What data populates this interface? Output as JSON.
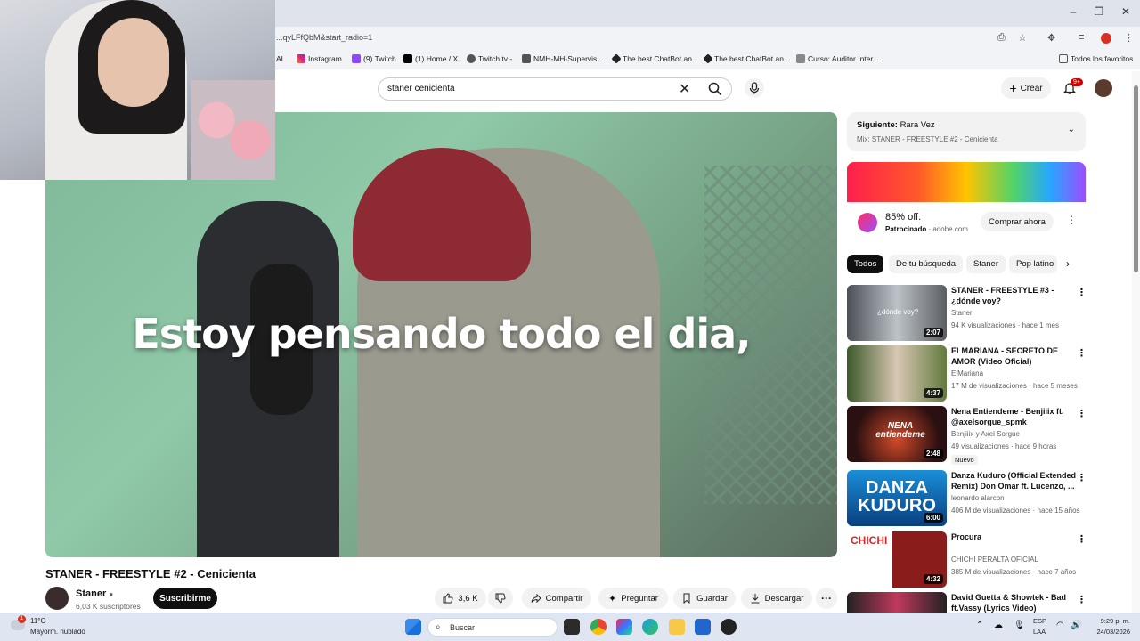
{
  "browser": {
    "url": "...qyLFfQbM&start_radio=1",
    "bookmarks": [
      "AL",
      "Instagram",
      "(9) Twitch",
      "(1) Home / X",
      "Twitch.tv -",
      "NMH-MH-Supervis...",
      "The best ChatBot an...",
      "The best ChatBot an...",
      "Curso: Auditor Inter..."
    ],
    "all_bookmarks": "Todos los favoritos"
  },
  "header": {
    "search_value": "staner cenicienta",
    "create_label": "Crear",
    "notif_badge": "9+"
  },
  "video": {
    "subtitle": "Estoy pensando todo el dia,",
    "title": "STANER - FREESTYLE #2 - Cenicienta",
    "channel": "Staner",
    "subscribers": "6,03 K suscriptores",
    "subscribe_label": "Suscribirme",
    "likes": "3,6 K",
    "share_label": "Compartir",
    "ask_label": "Preguntar",
    "save_label": "Guardar",
    "download_label": "Descargar"
  },
  "next": {
    "label": "Siguiente:",
    "title": "Rara Vez",
    "mix": "Mix: STANER - FREESTYLE #2 - Cenicienta"
  },
  "ad": {
    "price": "85% off.",
    "sponsored": "Patrocinado",
    "domain": "adobe.com",
    "cta": "Comprar ahora"
  },
  "chips": [
    "Todos",
    "De tu búsqueda",
    "Staner",
    "Pop latino"
  ],
  "recommendations": [
    {
      "title": "STANER - FREESTYLE #3 - ¿dónde voy?",
      "channel": "Staner",
      "meta": "94 K visualizaciones · hace 1 mes",
      "duration": "2:07",
      "thumb_text": "¿dónde voy?"
    },
    {
      "title": "ELMARIANA - SECRETO DE AMOR (Video Oficial)",
      "channel": "ElMariana",
      "meta": "17 M de visualizaciones · hace 5 meses",
      "duration": "4:37",
      "thumb_text": ""
    },
    {
      "title": "Nena Entiendeme - Benjiiix ft. @axelsorgue_spmk",
      "channel": "Benjiiix y Axel Sorgue",
      "meta": "49 visualizaciones · hace 9 horas",
      "duration": "2:48",
      "badge": "Nuevo",
      "thumb_text": "NENA entiendeme"
    },
    {
      "title": "Danza Kuduro (Official Extended Remix) Don Omar ft. Lucenzo, ...",
      "channel": "leonardo alarcon",
      "meta": "406 M de visualizaciones · hace 15 años",
      "duration": "6:00",
      "thumb_text": "DANZA KUDURO"
    },
    {
      "title": "Procura",
      "channel": "CHICHI PERALTA OFICIAL",
      "meta": "385 M de visualizaciones · hace 7 años",
      "duration": "4:32",
      "thumb_text": "CHICHI"
    },
    {
      "title": "David Guetta & Showtek - Bad ft.Vassy (Lyrics Video)",
      "channel": "",
      "meta": "",
      "duration": "",
      "thumb_text": ""
    }
  ],
  "taskbar": {
    "temp": "11°C",
    "weather": "Mayorm. nublado",
    "weather_badge": "1",
    "search_label": "Buscar",
    "lang": "ESP",
    "region": "LAA",
    "time": "9:29 p. m.",
    "date": "24/03/2026"
  },
  "colors": {
    "accent": "#cc0000",
    "yt_chip_bg": "#f2f2f2",
    "text": "#0f0f0f"
  }
}
